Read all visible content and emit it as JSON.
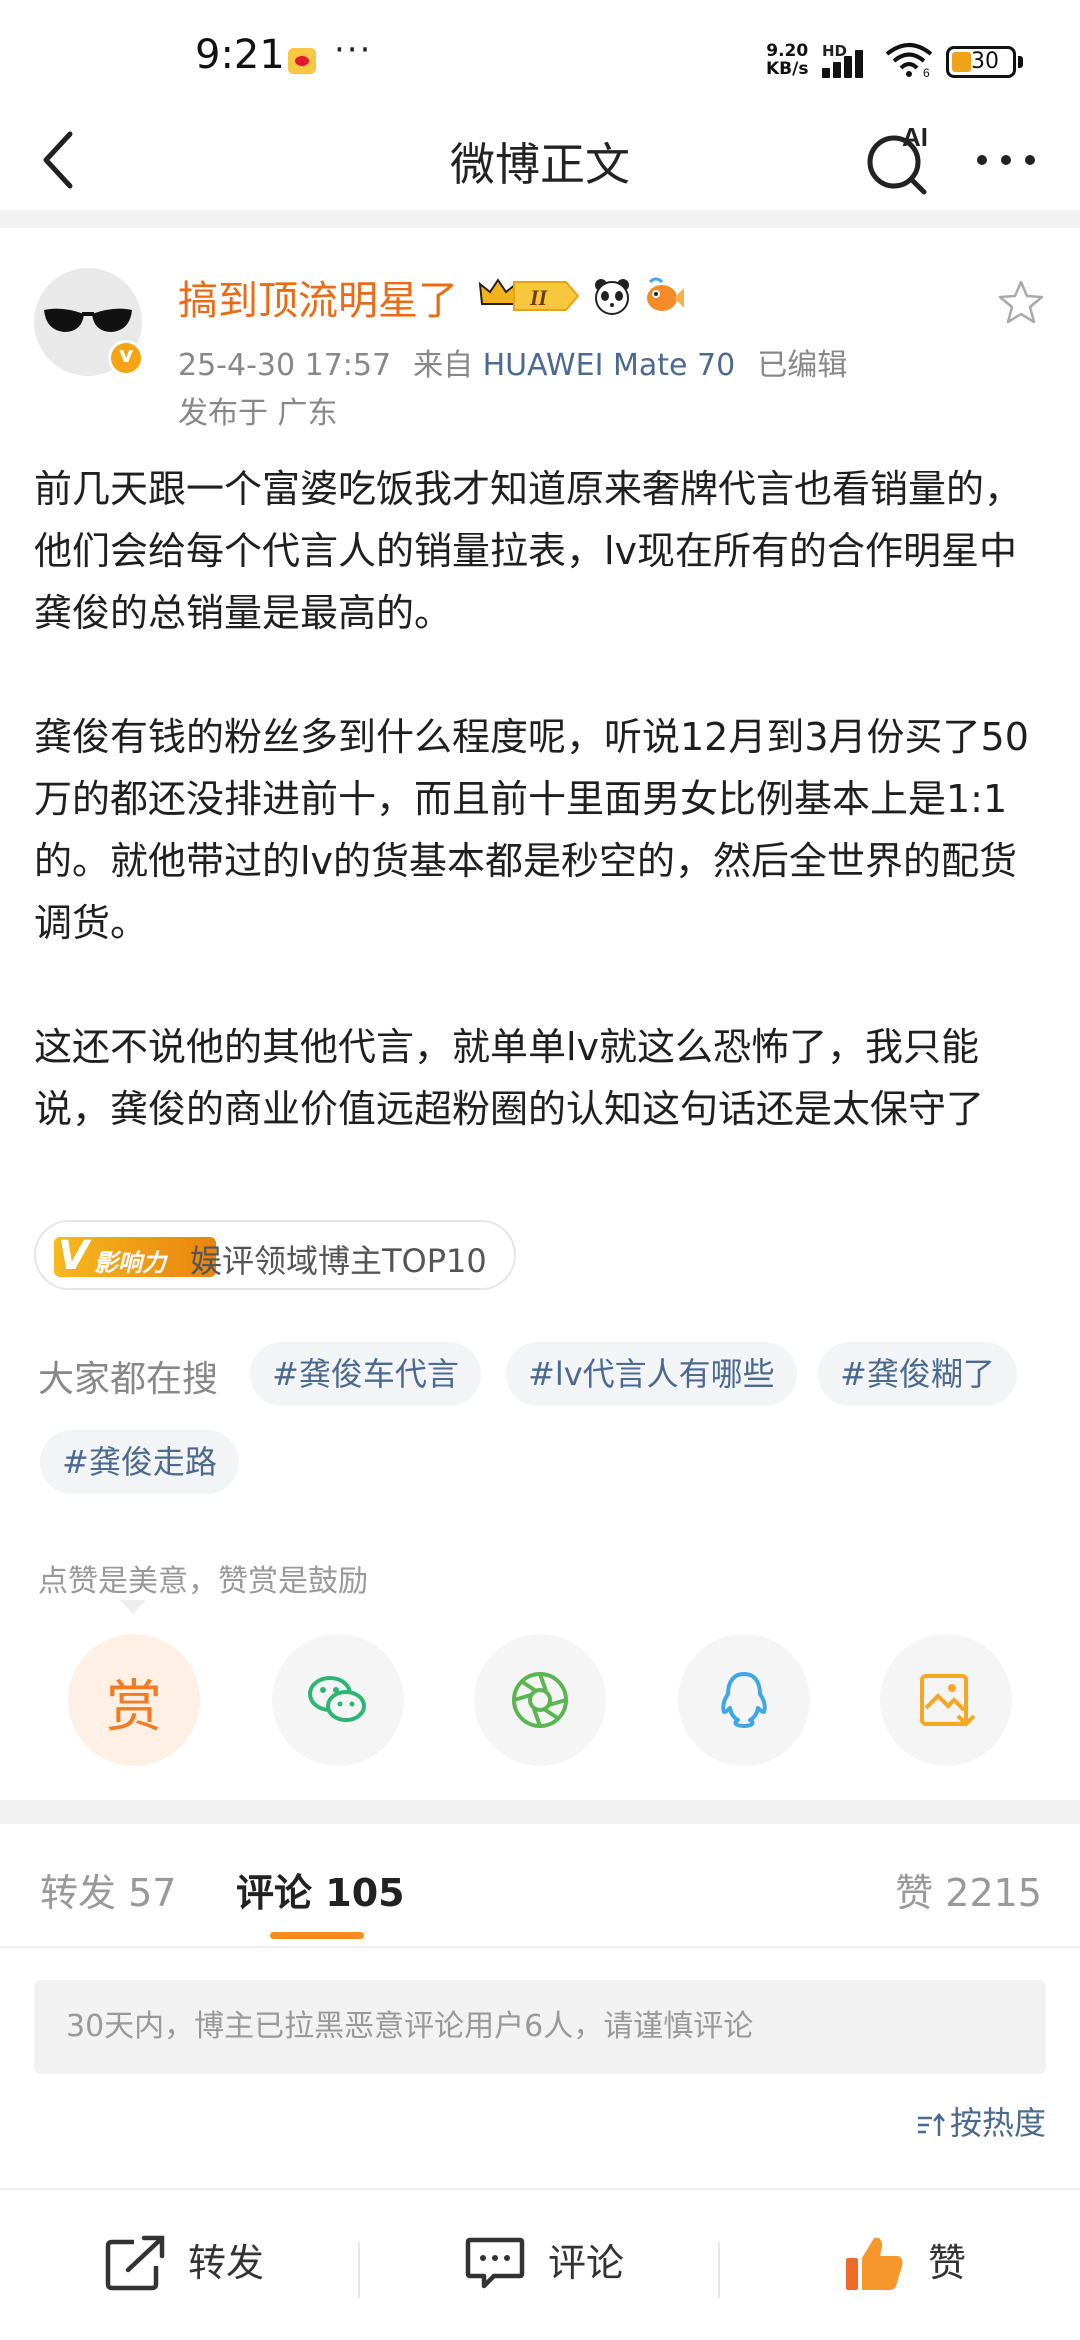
{
  "status_bar": {
    "time": "9:21",
    "more": "···",
    "net_speed_value": "9.20",
    "net_speed_unit": "KB/s",
    "network_type": "HD",
    "wifi_label": "6",
    "battery": "30"
  },
  "nav": {
    "title": "微博正文",
    "ai_label": "AI"
  },
  "post": {
    "username": "搞到顶流明星了",
    "crown_level": "II",
    "date": "25-4-30 17:57",
    "source_prefix": "来自",
    "device": "HUAWEI Mate 70",
    "edited": "已编辑",
    "location": "发布于 广东",
    "paragraphs": [
      "前几天跟一个富婆吃饭我才知道原来奢牌代言也看销量的，他们会给每个代言人的销量拉表，lv现在所有的合作明星中龚俊的总销量是最高的。",
      "龚俊有钱的粉丝多到什么程度呢，听说12月到3月份买了50万的都还没排进前十，而且前十里面男女比例基本上是1:1的。就他带过的lv的货基本都是秒空的，然后全世界的配货调货。",
      "这还不说他的其他代言，就单单lv就这么恐怖了，我只能说，龚俊的商业价值远超粉圈的认知这句话还是太保守了"
    ],
    "influence_badge": "影响力",
    "influence_badge_v": "V",
    "influence_text": "娱评领域博主TOP10"
  },
  "hot_search": {
    "label": "大家都在搜",
    "items": [
      "#龚俊车代言",
      "#lv代言人有哪些",
      "#龚俊糊了",
      "#龚俊走路"
    ]
  },
  "reward": {
    "hint": "点赞是美意，赞赏是鼓励",
    "reward_label": "赏"
  },
  "tabs": {
    "repost_label": "转发",
    "repost_count": "57",
    "comment_label": "评论",
    "comment_count": "105",
    "like_label": "赞",
    "like_count": "2215"
  },
  "comments": {
    "notice": "30天内，博主已拉黑恶意评论用户6人，请谨慎评论",
    "sort_label": "按热度"
  },
  "bottom_bar": {
    "repost": "转发",
    "comment": "评论",
    "like": "赞"
  },
  "colors": {
    "accent_orange": "#f78a1e",
    "username_orange": "#ec6a13",
    "link_blue": "#4c6a8f",
    "wechat_green": "#2bb673",
    "moments_green": "#5ab552",
    "qq_blue": "#3fa7e6",
    "save_yellow": "#f5a623"
  }
}
